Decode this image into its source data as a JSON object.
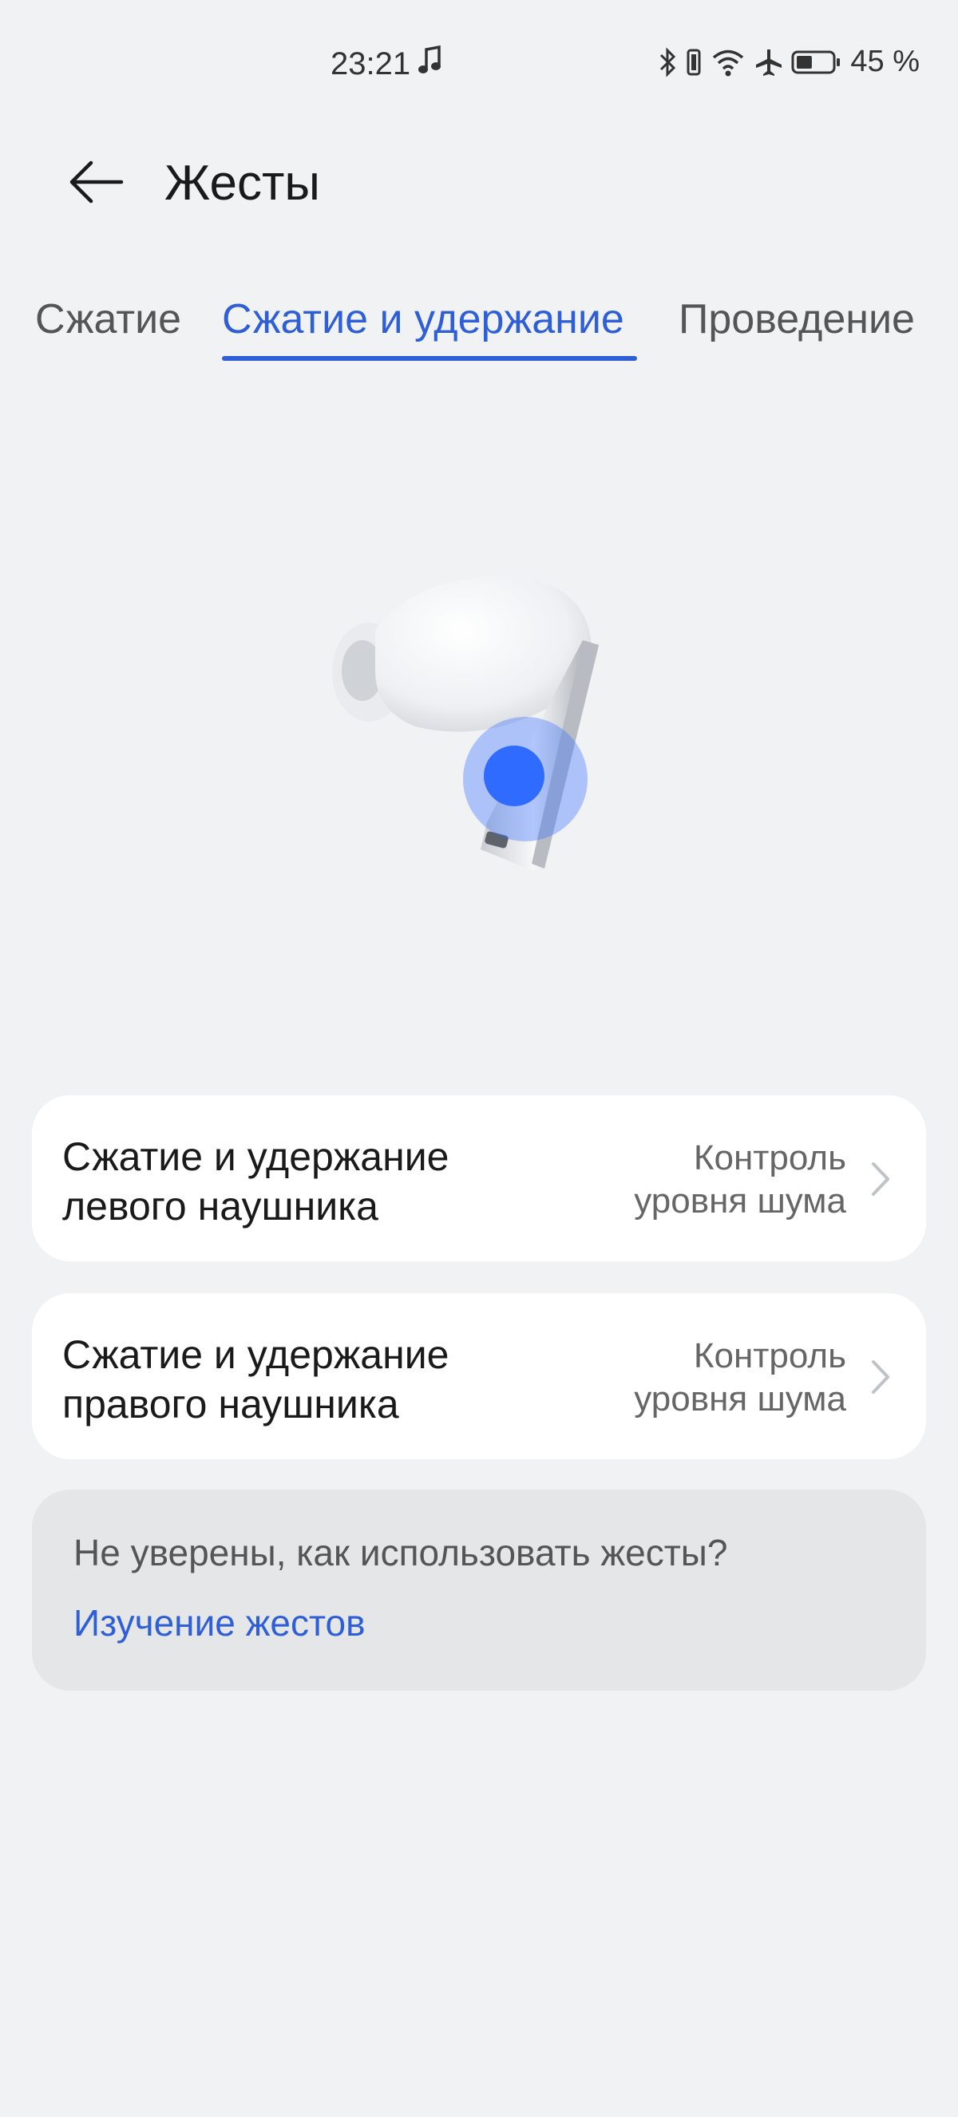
{
  "status_bar": {
    "time": "23:21",
    "battery_percent": "45 %",
    "battery_level": 0.45,
    "icons": [
      "music-note-icon",
      "bluetooth-icon",
      "vibrate-icon",
      "wifi-icon",
      "airplane-icon",
      "battery-icon"
    ]
  },
  "header": {
    "title": "Жесты",
    "back_icon": "arrow-left-icon"
  },
  "tabs": [
    {
      "label": "Сжатие",
      "active": false
    },
    {
      "label": "Сжатие и удержание",
      "active": true
    },
    {
      "label": "Проведение",
      "active": false
    }
  ],
  "settings": [
    {
      "title_line1": "Сжатие и удержание",
      "title_line2": "левого наушника",
      "value_line1": "Контроль",
      "value_line2": "уровня шума"
    },
    {
      "title_line1": "Сжатие и удержание",
      "title_line2": "правого наушника",
      "value_line1": "Контроль",
      "value_line2": "уровня шума"
    }
  ],
  "help": {
    "question": "Не уверены, как использовать жесты?",
    "link": "Изучение жестов"
  },
  "colors": {
    "accent": "#2f5fd6",
    "background": "#f1f2f4",
    "card": "#ffffff",
    "help_card": "#e5e6e8",
    "gesture_dot": "#2f6bff"
  }
}
